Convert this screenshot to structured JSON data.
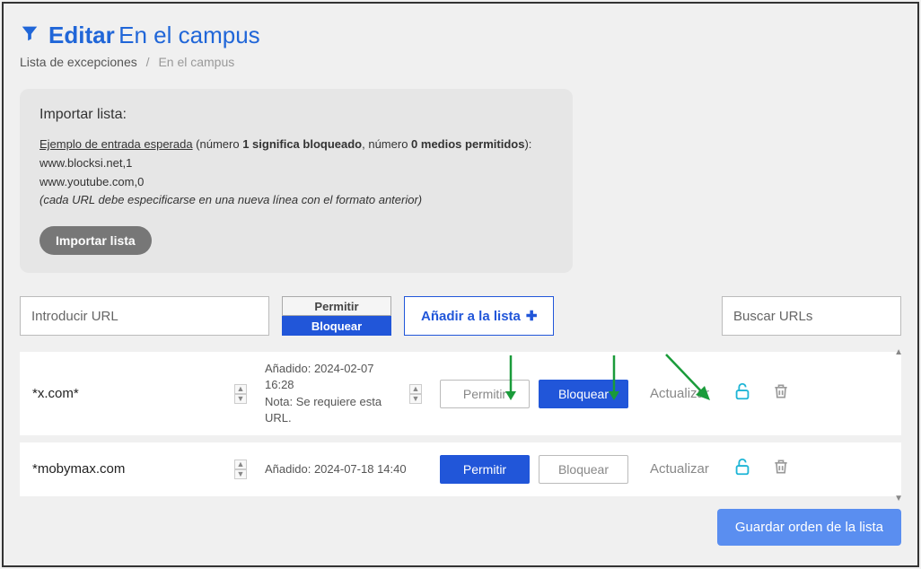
{
  "header": {
    "edit": "Editar",
    "name": "En el campus"
  },
  "breadcrumb": {
    "link": "Lista de excepciones",
    "sep": "/",
    "current": "En el campus"
  },
  "import_card": {
    "title": "Importar lista:",
    "example_label": "Ejemplo de entrada esperada",
    "desc_open": " (número ",
    "one_means": "1 significa bloqueado",
    "desc_mid": ", número ",
    "zero_means": "0 medios permitidos",
    "desc_close": "):",
    "line1": "www.blocksi.net,1",
    "line2": "www.youtube.com,0",
    "note": "(cada URL debe especificarse en una nueva línea con el formato anterior)",
    "button": "Importar lista"
  },
  "controls": {
    "url_placeholder": "Introducir URL",
    "allow": "Permitir",
    "block": "Bloquear",
    "add": "Añadir a la lista",
    "search_placeholder": "Buscar URLs"
  },
  "rows": [
    {
      "url": "*x.com*",
      "added_label": "Añadido:",
      "added_value": "2024-02-07 16:28",
      "note_label": "Nota:",
      "note_value": "Se requiere esta URL.",
      "allow": "Permitir",
      "block": "Bloquear",
      "update": "Actualizar",
      "state": "blocked"
    },
    {
      "url": "*mobymax.com",
      "added_label": "Añadido:",
      "added_value": "2024-07-18 14:40",
      "note_label": "",
      "note_value": "",
      "allow": "Permitir",
      "block": "Bloquear",
      "update": "Actualizar",
      "state": "allowed"
    }
  ],
  "save": "Guardar orden de la lista"
}
